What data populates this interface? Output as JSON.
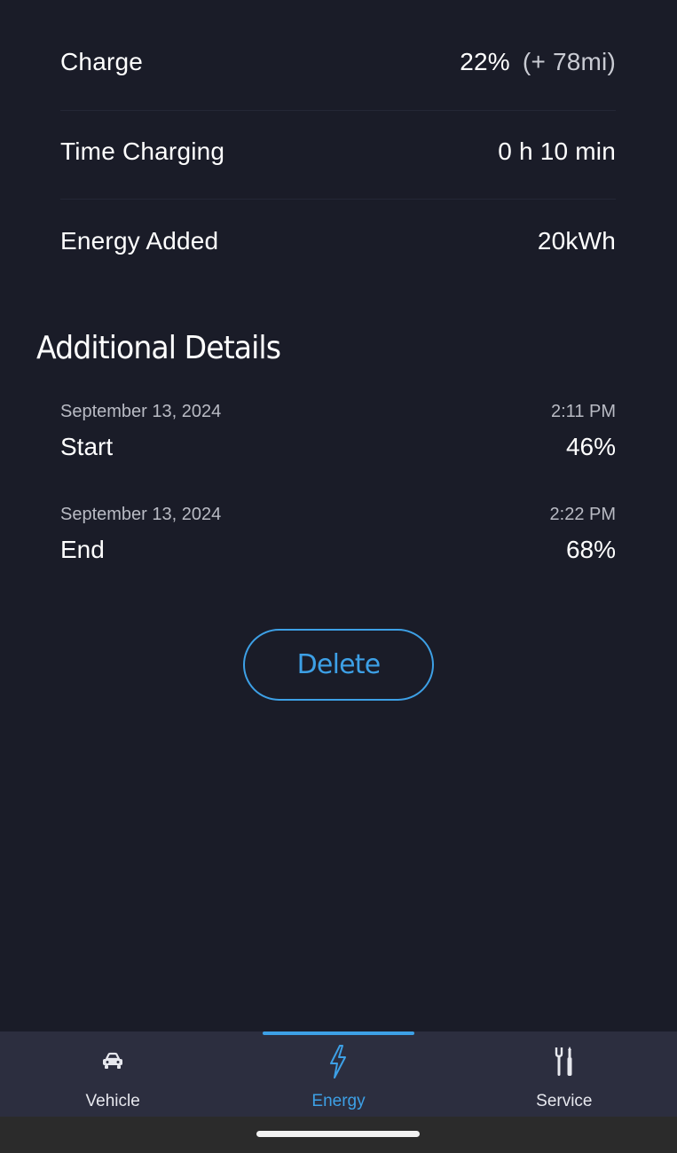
{
  "summary": {
    "charge": {
      "label": "Charge",
      "value": "22%",
      "sub": "(+ 78mi)"
    },
    "time_charging": {
      "label": "Time Charging",
      "value": "0 h 10 min"
    },
    "energy_added": {
      "label": "Energy Added",
      "value": "20kWh"
    }
  },
  "additional": {
    "title": "Additional Details",
    "start": {
      "date": "September 13, 2024",
      "time": "2:11 PM",
      "label": "Start",
      "value": "46%"
    },
    "end": {
      "date": "September 13, 2024",
      "time": "2:22 PM",
      "label": "End",
      "value": "68%"
    }
  },
  "actions": {
    "delete_label": "Delete"
  },
  "tabs": {
    "vehicle": {
      "label": "Vehicle",
      "icon": "car-icon"
    },
    "energy": {
      "label": "Energy",
      "icon": "lightning-bolt-icon",
      "active": true
    },
    "service": {
      "label": "Service",
      "icon": "tools-icon"
    }
  },
  "colors": {
    "background": "#1a1c28",
    "accent": "#3da0e6",
    "tabbar": "#2c2e3f"
  }
}
